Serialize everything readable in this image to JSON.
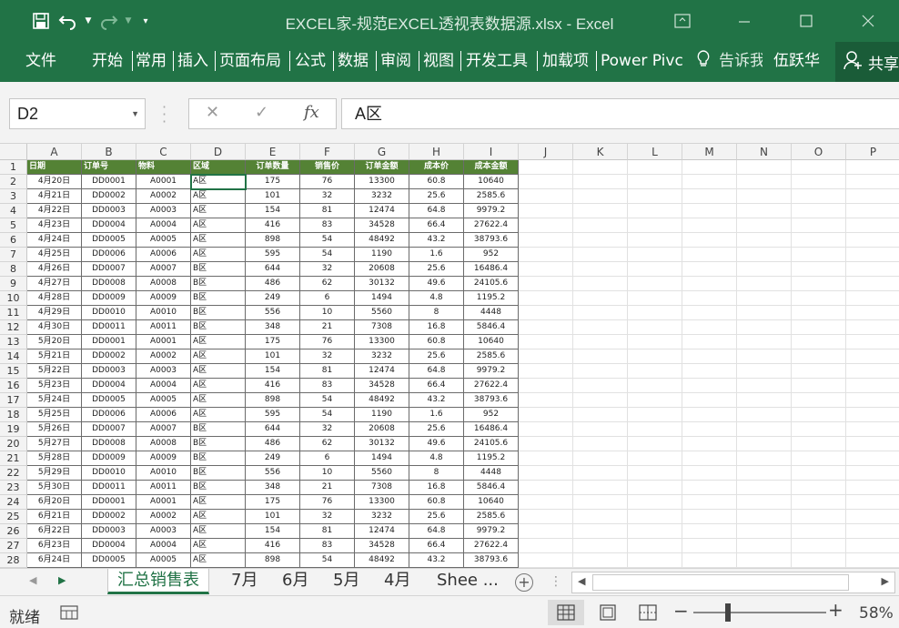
{
  "window": {
    "title": "EXCEL家-规范EXCEL透视表数据源.xlsx - Excel",
    "quick_access": {
      "save": "save-icon",
      "undo": "undo-icon",
      "redo": "redo-icon",
      "customize": "customize-icon"
    }
  },
  "ribbon": {
    "tabs": [
      "文件",
      "开始",
      "常用",
      "插入",
      "页面布局",
      "公式",
      "数据",
      "审阅",
      "视图",
      "开发工具",
      "加载项",
      "Power Pivc"
    ],
    "tell_me": "告诉我",
    "user": "伍跃华",
    "share": "共享"
  },
  "formula_bar": {
    "name_box": "D2",
    "cancel_glyph": "✕",
    "enter_glyph": "✓",
    "fx_glyph": "fx",
    "content": "A区"
  },
  "grid": {
    "columns": [
      "A",
      "B",
      "C",
      "D",
      "E",
      "F",
      "G",
      "H",
      "I",
      "J",
      "K",
      "L",
      "M",
      "N",
      "O",
      "P"
    ],
    "row_numbers": [
      "1",
      "2",
      "3",
      "4",
      "5",
      "6",
      "7",
      "8",
      "9",
      "10",
      "11",
      "12",
      "13",
      "14",
      "15",
      "16",
      "17",
      "18",
      "19",
      "20",
      "21",
      "22",
      "23",
      "24",
      "25",
      "26",
      "27",
      "28"
    ],
    "header": [
      "日期",
      "订单号",
      "物料",
      "区域",
      "订单数量",
      "销售价",
      "订单金额",
      "成本价",
      "成本金额"
    ],
    "rows": [
      [
        "4月20日",
        "DD0001",
        "A0001",
        "A区",
        "175",
        "76",
        "13300",
        "60.8",
        "10640"
      ],
      [
        "4月21日",
        "DD0002",
        "A0002",
        "A区",
        "101",
        "32",
        "3232",
        "25.6",
        "2585.6"
      ],
      [
        "4月22日",
        "DD0003",
        "A0003",
        "A区",
        "154",
        "81",
        "12474",
        "64.8",
        "9979.2"
      ],
      [
        "4月23日",
        "DD0004",
        "A0004",
        "A区",
        "416",
        "83",
        "34528",
        "66.4",
        "27622.4"
      ],
      [
        "4月24日",
        "DD0005",
        "A0005",
        "A区",
        "898",
        "54",
        "48492",
        "43.2",
        "38793.6"
      ],
      [
        "4月25日",
        "DD0006",
        "A0006",
        "A区",
        "595",
        "54",
        "1190",
        "1.6",
        "952"
      ],
      [
        "4月26日",
        "DD0007",
        "A0007",
        "B区",
        "644",
        "32",
        "20608",
        "25.6",
        "16486.4"
      ],
      [
        "4月27日",
        "DD0008",
        "A0008",
        "B区",
        "486",
        "62",
        "30132",
        "49.6",
        "24105.6"
      ],
      [
        "4月28日",
        "DD0009",
        "A0009",
        "B区",
        "249",
        "6",
        "1494",
        "4.8",
        "1195.2"
      ],
      [
        "4月29日",
        "DD0010",
        "A0010",
        "B区",
        "556",
        "10",
        "5560",
        "8",
        "4448"
      ],
      [
        "4月30日",
        "DD0011",
        "A0011",
        "B区",
        "348",
        "21",
        "7308",
        "16.8",
        "5846.4"
      ],
      [
        "5月20日",
        "DD0001",
        "A0001",
        "A区",
        "175",
        "76",
        "13300",
        "60.8",
        "10640"
      ],
      [
        "5月21日",
        "DD0002",
        "A0002",
        "A区",
        "101",
        "32",
        "3232",
        "25.6",
        "2585.6"
      ],
      [
        "5月22日",
        "DD0003",
        "A0003",
        "A区",
        "154",
        "81",
        "12474",
        "64.8",
        "9979.2"
      ],
      [
        "5月23日",
        "DD0004",
        "A0004",
        "A区",
        "416",
        "83",
        "34528",
        "66.4",
        "27622.4"
      ],
      [
        "5月24日",
        "DD0005",
        "A0005",
        "A区",
        "898",
        "54",
        "48492",
        "43.2",
        "38793.6"
      ],
      [
        "5月25日",
        "DD0006",
        "A0006",
        "A区",
        "595",
        "54",
        "1190",
        "1.6",
        "952"
      ],
      [
        "5月26日",
        "DD0007",
        "A0007",
        "B区",
        "644",
        "32",
        "20608",
        "25.6",
        "16486.4"
      ],
      [
        "5月27日",
        "DD0008",
        "A0008",
        "B区",
        "486",
        "62",
        "30132",
        "49.6",
        "24105.6"
      ],
      [
        "5月28日",
        "DD0009",
        "A0009",
        "B区",
        "249",
        "6",
        "1494",
        "4.8",
        "1195.2"
      ],
      [
        "5月29日",
        "DD0010",
        "A0010",
        "B区",
        "556",
        "10",
        "5560",
        "8",
        "4448"
      ],
      [
        "5月30日",
        "DD0011",
        "A0011",
        "B区",
        "348",
        "21",
        "7308",
        "16.8",
        "5846.4"
      ],
      [
        "6月20日",
        "DD0001",
        "A0001",
        "A区",
        "175",
        "76",
        "13300",
        "60.8",
        "10640"
      ],
      [
        "6月21日",
        "DD0002",
        "A0002",
        "A区",
        "101",
        "32",
        "3232",
        "25.6",
        "2585.6"
      ],
      [
        "6月22日",
        "DD0003",
        "A0003",
        "A区",
        "154",
        "81",
        "12474",
        "64.8",
        "9979.2"
      ],
      [
        "6月23日",
        "DD0004",
        "A0004",
        "A区",
        "416",
        "83",
        "34528",
        "66.4",
        "27622.4"
      ],
      [
        "6月24日",
        "DD0005",
        "A0005",
        "A区",
        "898",
        "54",
        "48492",
        "43.2",
        "38793.6"
      ]
    ],
    "header_color": "#548235"
  },
  "sheets": {
    "tabs": [
      "汇总销售表",
      "7月",
      "6月",
      "5月",
      "4月",
      "Shee ..."
    ],
    "active": "汇总销售表",
    "add_glyph": "+"
  },
  "status": {
    "ready": "就绪",
    "zoom": "58%",
    "zoom_minus": "−",
    "zoom_plus": "+"
  },
  "colors": {
    "brand": "#217346",
    "header_fill": "#548235"
  }
}
